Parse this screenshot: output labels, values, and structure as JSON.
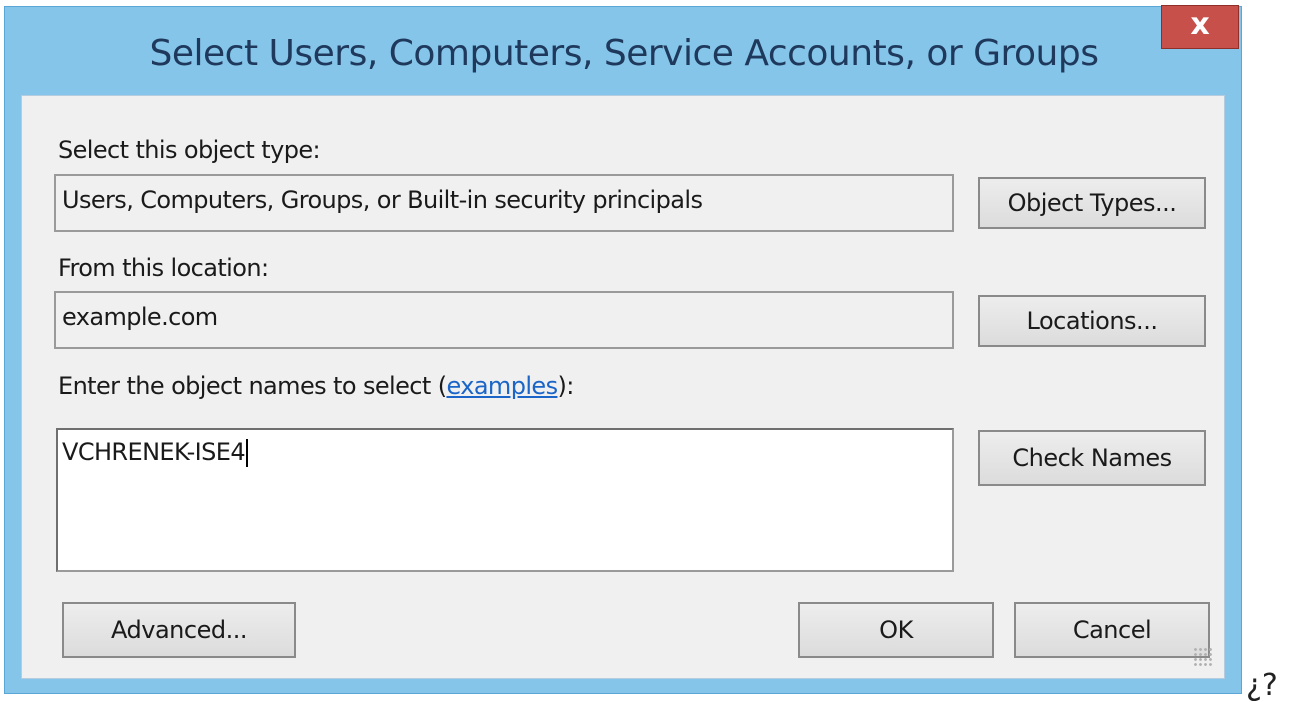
{
  "window": {
    "title": "Select Users, Computers, Service Accounts, or Groups",
    "close_label": "x"
  },
  "object_type": {
    "label": "Select this object type:",
    "value": "Users, Computers, Groups, or Built-in security principals",
    "button_label": "Object Types..."
  },
  "location": {
    "label": "From this location:",
    "value": "example.com",
    "button_label": "Locations..."
  },
  "names": {
    "label_prefix": "Enter the object names to select (",
    "label_link": "examples",
    "label_suffix": "):",
    "value": "VCHRENEK-ISE4",
    "check_button_label": "Check Names"
  },
  "footer": {
    "advanced_label": "Advanced...",
    "ok_label": "OK",
    "cancel_label": "Cancel"
  },
  "stray_text": "¿?"
}
